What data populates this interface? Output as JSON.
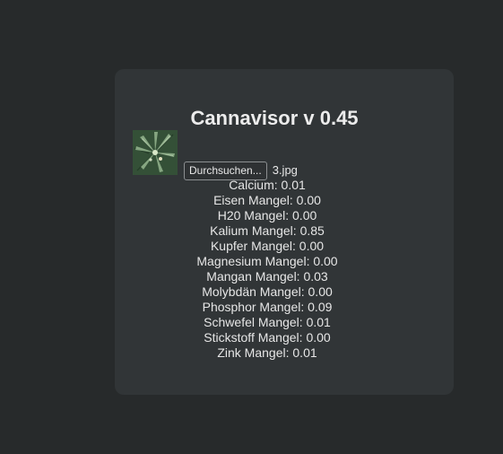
{
  "app": {
    "title": "Cannavisor v 0.45"
  },
  "upload": {
    "button_label": "Durchsuchen...",
    "file_name": "3.jpg",
    "thumbnail": "cannabis-leaf-photo"
  },
  "results": [
    {
      "label": "Calcium:",
      "value": "0.01"
    },
    {
      "label": "Eisen Mangel:",
      "value": "0.00"
    },
    {
      "label": "H20 Mangel:",
      "value": "0.00"
    },
    {
      "label": "Kalium Mangel:",
      "value": "0.85"
    },
    {
      "label": "Kupfer Mangel:",
      "value": "0.00"
    },
    {
      "label": "Magnesium Mangel:",
      "value": "0.00"
    },
    {
      "label": "Mangan Mangel:",
      "value": "0.03"
    },
    {
      "label": "Molybdän Mangel:",
      "value": "0.00"
    },
    {
      "label": "Phosphor Mangel:",
      "value": "0.09"
    },
    {
      "label": "Schwefel Mangel:",
      "value": "0.01"
    },
    {
      "label": "Stickstoff Mangel:",
      "value": "0.00"
    },
    {
      "label": "Zink Mangel:",
      "value": "0.01"
    }
  ],
  "colors": {
    "background": "#272a2b",
    "card": "#313537",
    "text": "#e6e6e6"
  }
}
